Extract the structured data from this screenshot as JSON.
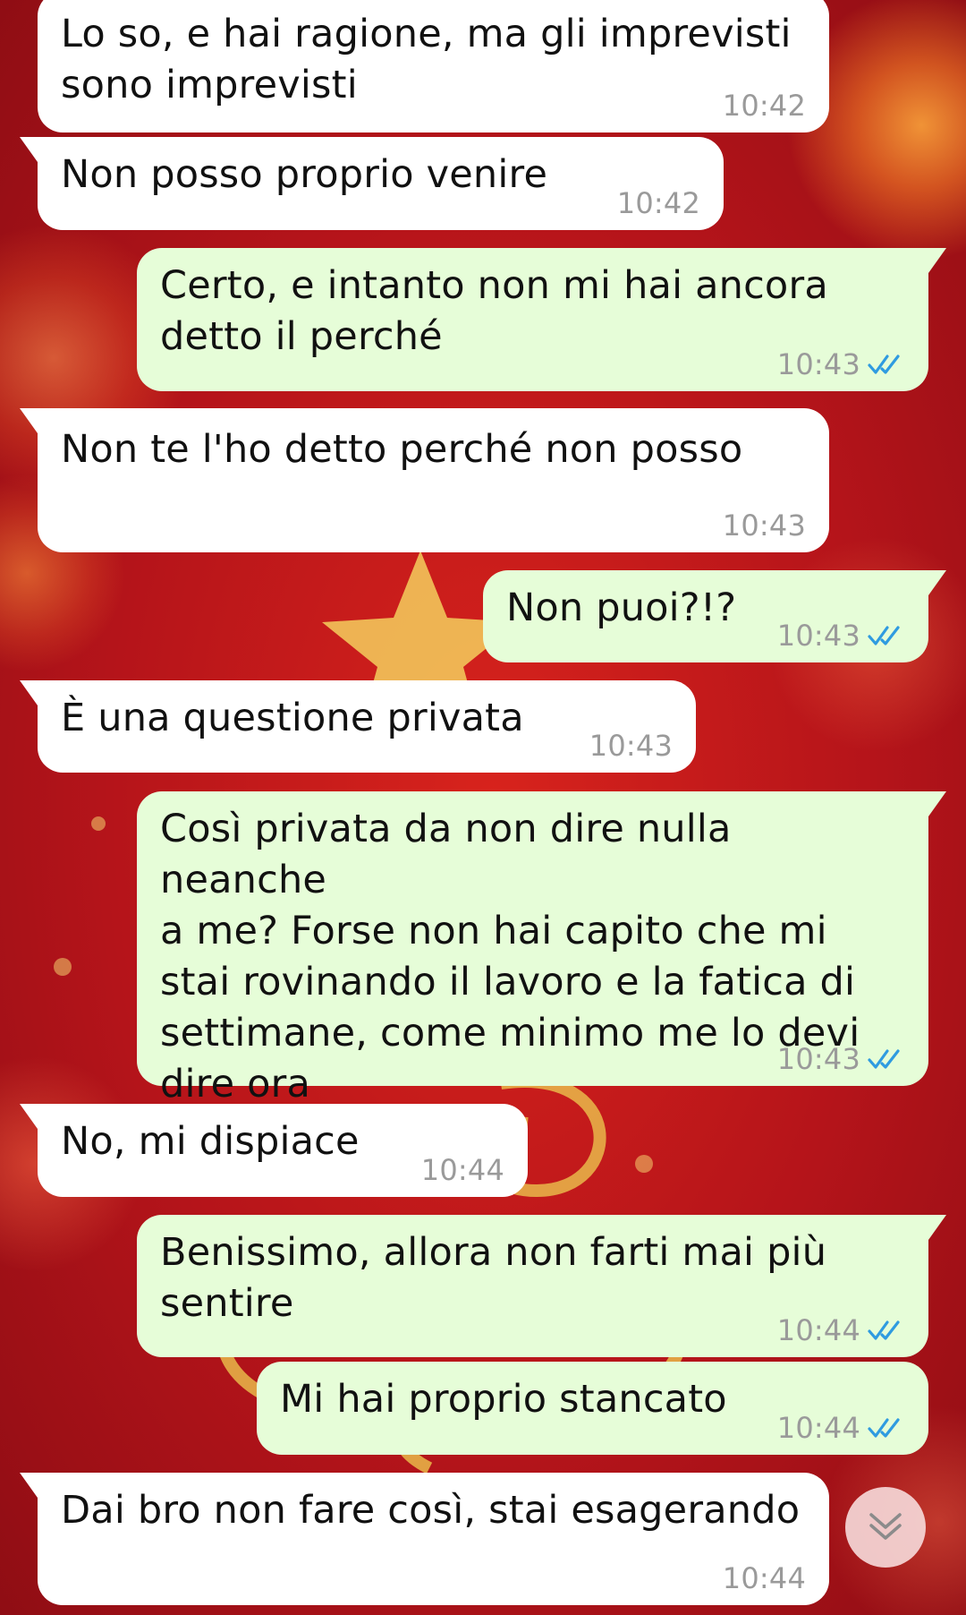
{
  "chat": {
    "messages": [
      {
        "dir": "in",
        "text": "Lo so, e hai ragione, ma gli imprevisti\nsono imprevisti",
        "time": "10:42"
      },
      {
        "dir": "in",
        "text": "Non posso proprio venire",
        "time": "10:42"
      },
      {
        "dir": "out",
        "text": "Certo, e intanto non mi hai ancora\ndetto il perché",
        "time": "10:43",
        "status": "read"
      },
      {
        "dir": "in",
        "text": "Non te l'ho detto perché non posso",
        "time": "10:43"
      },
      {
        "dir": "out",
        "text": "Non puoi?!?",
        "time": "10:43",
        "status": "read"
      },
      {
        "dir": "in",
        "text": "È una questione privata",
        "time": "10:43"
      },
      {
        "dir": "out",
        "text": "Così privata da non dire nulla neanche\na me? Forse non hai capito che mi\nstai rovinando il lavoro e la fatica di\nsettimane, come minimo me lo devi\ndire ora",
        "time": "10:43",
        "status": "read"
      },
      {
        "dir": "in",
        "text": "No, mi dispiace",
        "time": "10:44"
      },
      {
        "dir": "out",
        "text": "Benissimo, allora non farti mai più\nsentire",
        "time": "10:44",
        "status": "read"
      },
      {
        "dir": "out",
        "text": "Mi hai proprio stancato",
        "time": "10:44",
        "status": "read"
      },
      {
        "dir": "in",
        "text": "Dai bro non fare così, stai esagerando",
        "time": "10:44"
      }
    ]
  },
  "icons": {
    "read_receipt": "double-check-icon",
    "scroll_down": "double-chevron-down-icon"
  },
  "colors": {
    "incoming_bubble": "#ffffff",
    "outgoing_bubble": "#e6fdd8",
    "timestamp": "#9a9a9a",
    "read_ticks": "#2f9be0",
    "background": "#c8181b"
  }
}
